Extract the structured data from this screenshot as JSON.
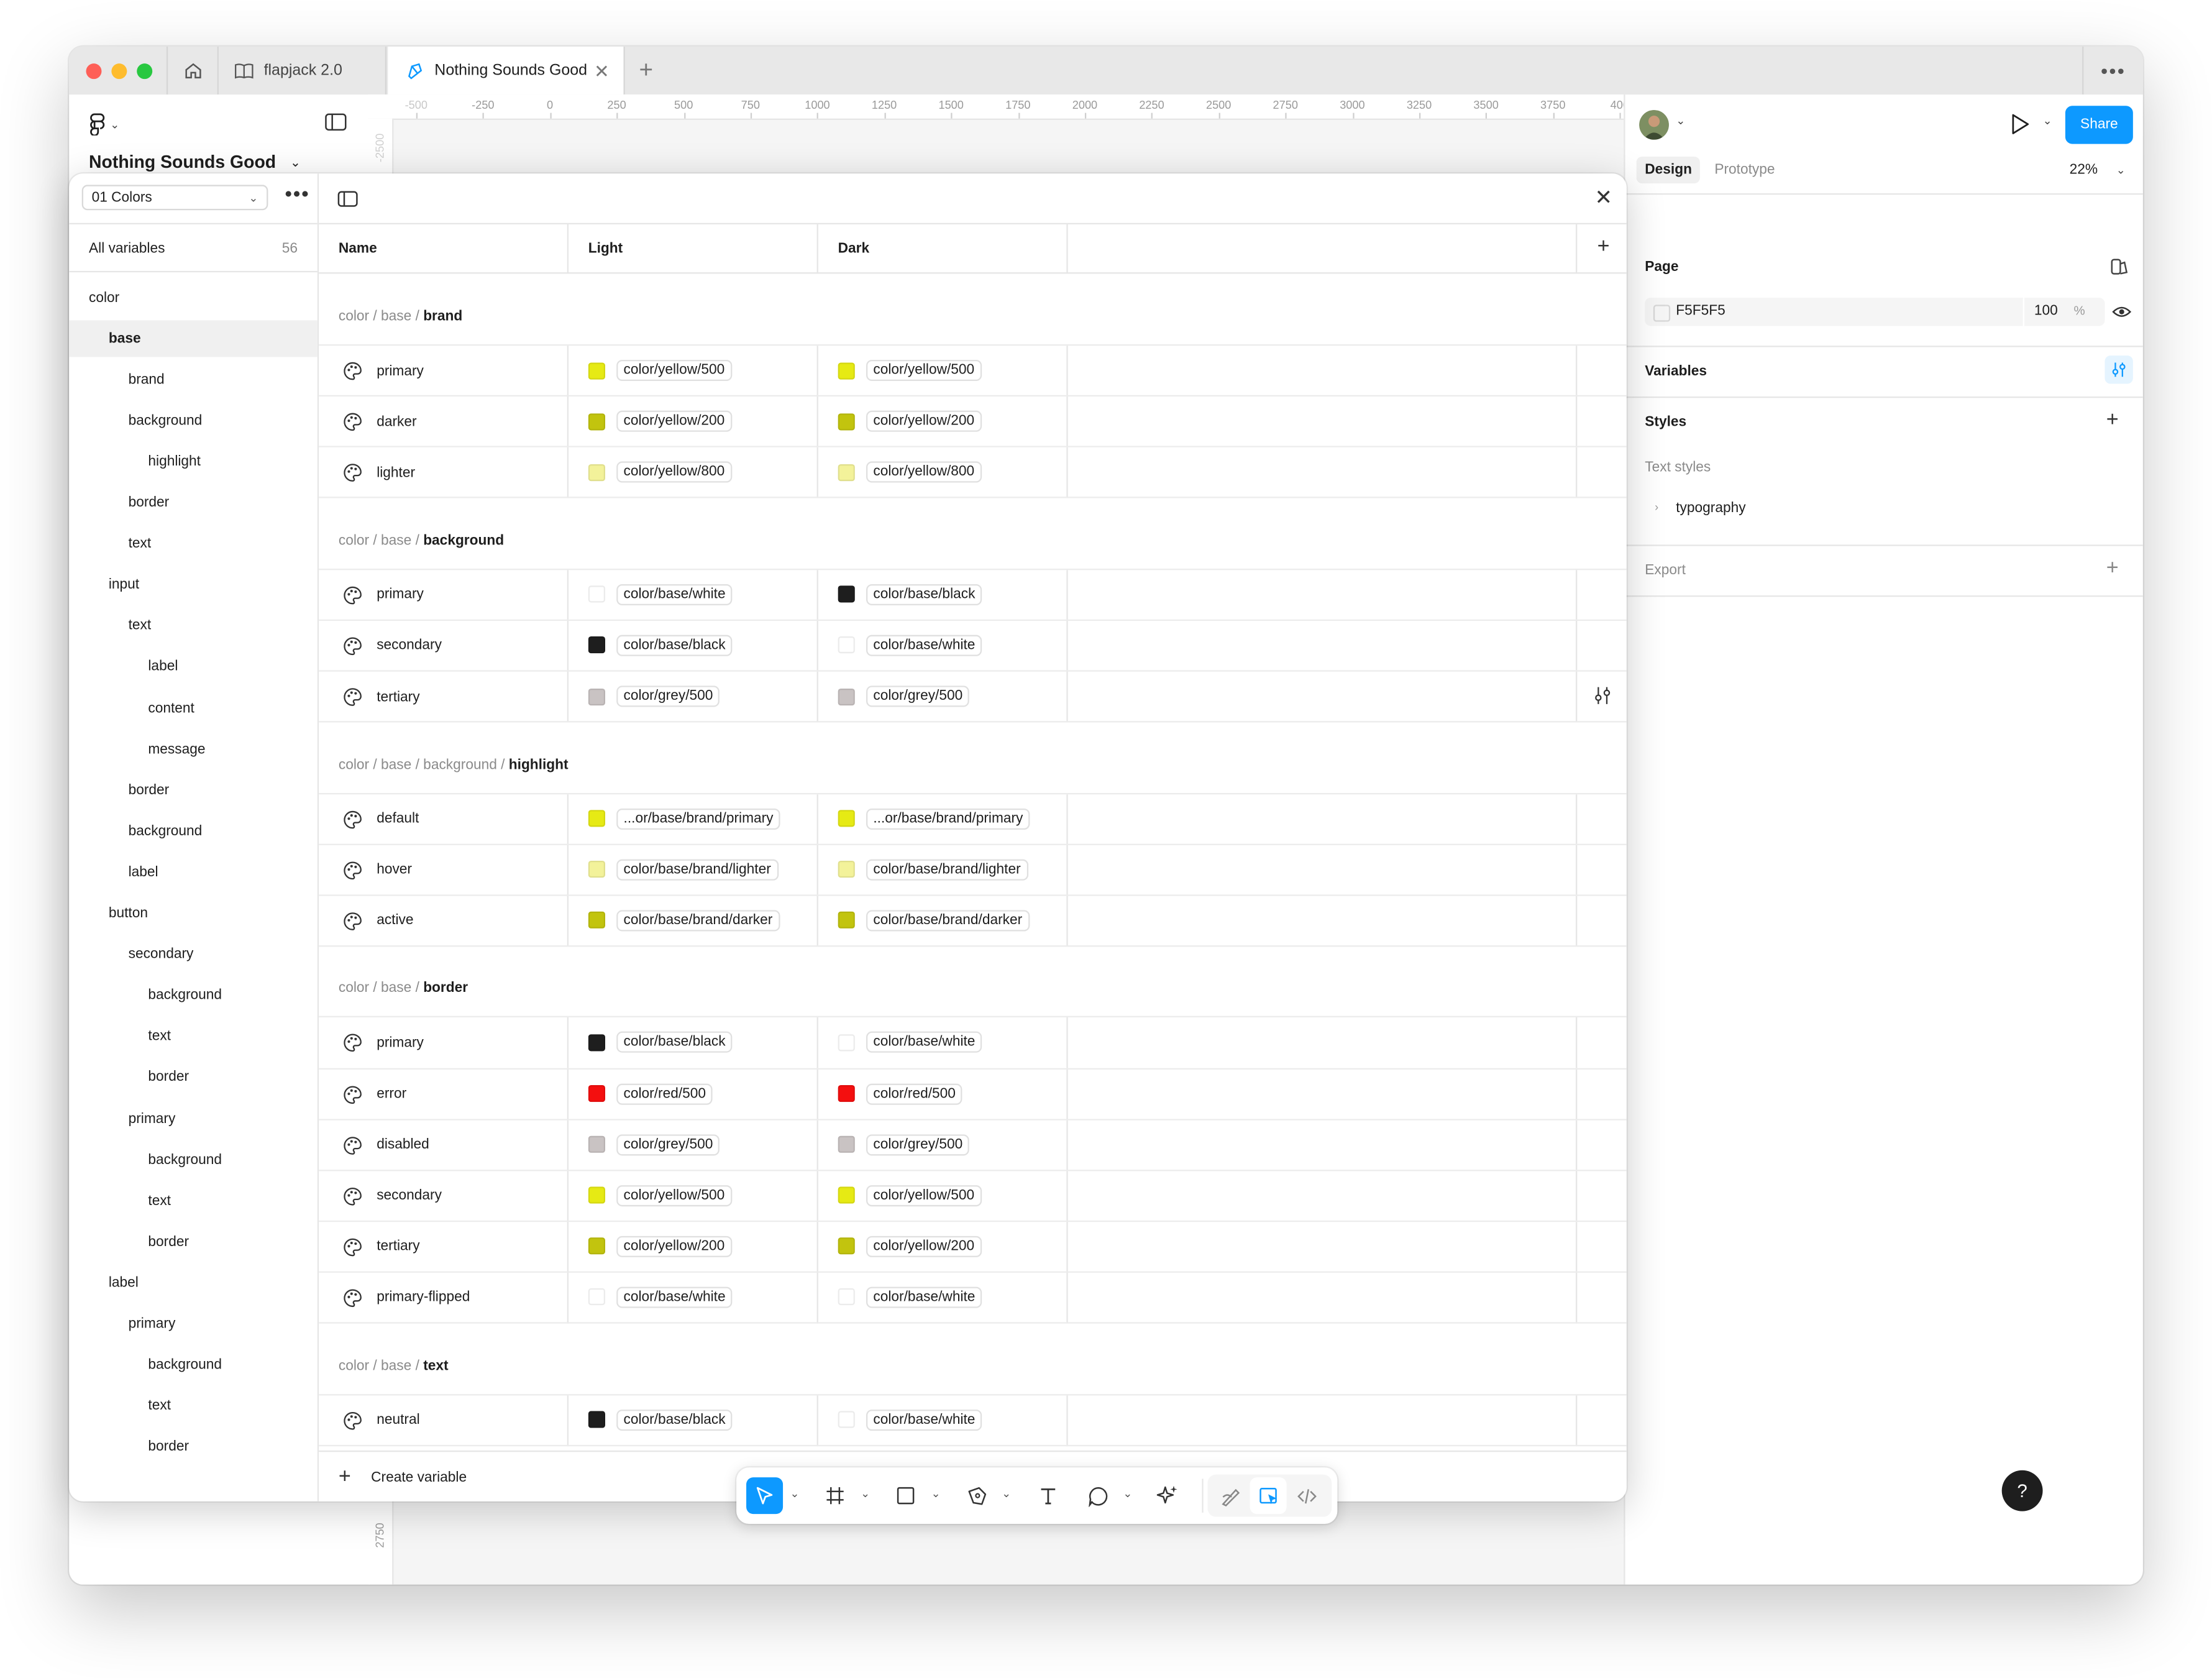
{
  "window": {
    "tabs": [
      {
        "label": "flapjack 2.0"
      },
      {
        "label": "Nothing Sounds Good"
      }
    ]
  },
  "left_panel": {
    "file_name": "Nothing Sounds Good"
  },
  "ruler": {
    "h_labels": [
      "-500",
      "-250",
      "0",
      "250",
      "500",
      "750",
      "1000",
      "1250",
      "1500",
      "1750",
      "2000",
      "2250",
      "2500",
      "2750",
      "3000",
      "3250",
      "3500",
      "3750",
      "400"
    ],
    "v_labels": [
      "-2500",
      "2750"
    ]
  },
  "variables_modal": {
    "collection": "01 Colors",
    "all_variables_label": "All variables",
    "all_variables_count": "56",
    "tree": [
      {
        "label": "color",
        "level": 0,
        "selected": false
      },
      {
        "label": "base",
        "level": 1,
        "selected": true
      },
      {
        "label": "brand",
        "level": 2,
        "selected": false
      },
      {
        "label": "background",
        "level": 2,
        "selected": false
      },
      {
        "label": "highlight",
        "level": 3,
        "selected": false
      },
      {
        "label": "border",
        "level": 2,
        "selected": false
      },
      {
        "label": "text",
        "level": 2,
        "selected": false
      },
      {
        "label": "input",
        "level": 1,
        "selected": false
      },
      {
        "label": "text",
        "level": 2,
        "selected": false
      },
      {
        "label": "label",
        "level": 3,
        "selected": false
      },
      {
        "label": "content",
        "level": 3,
        "selected": false
      },
      {
        "label": "message",
        "level": 3,
        "selected": false
      },
      {
        "label": "border",
        "level": 2,
        "selected": false
      },
      {
        "label": "background",
        "level": 2,
        "selected": false
      },
      {
        "label": "label",
        "level": 2,
        "selected": false
      },
      {
        "label": "button",
        "level": 1,
        "selected": false
      },
      {
        "label": "secondary",
        "level": 2,
        "selected": false
      },
      {
        "label": "background",
        "level": 3,
        "selected": false
      },
      {
        "label": "text",
        "level": 3,
        "selected": false
      },
      {
        "label": "border",
        "level": 3,
        "selected": false
      },
      {
        "label": "primary",
        "level": 2,
        "selected": false
      },
      {
        "label": "background",
        "level": 3,
        "selected": false
      },
      {
        "label": "text",
        "level": 3,
        "selected": false
      },
      {
        "label": "border",
        "level": 3,
        "selected": false
      },
      {
        "label": "label",
        "level": 1,
        "selected": false
      },
      {
        "label": "primary",
        "level": 2,
        "selected": false
      },
      {
        "label": "background",
        "level": 3,
        "selected": false
      },
      {
        "label": "text",
        "level": 3,
        "selected": false
      },
      {
        "label": "border",
        "level": 3,
        "selected": false
      }
    ],
    "columns": {
      "name": "Name",
      "light": "Light",
      "dark": "Dark"
    },
    "groups": [
      {
        "path": "color / base / ",
        "leaf": "brand",
        "rows": [
          {
            "name": "primary",
            "light": {
              "color": "#e6ea14",
              "ref": "color/yellow/500"
            },
            "dark": {
              "color": "#e6ea14",
              "ref": "color/yellow/500"
            }
          },
          {
            "name": "darker",
            "light": {
              "color": "#c2c40e",
              "ref": "color/yellow/200"
            },
            "dark": {
              "color": "#c2c40e",
              "ref": "color/yellow/200"
            }
          },
          {
            "name": "lighter",
            "light": {
              "color": "#f3f29a",
              "ref": "color/yellow/800"
            },
            "dark": {
              "color": "#f3f29a",
              "ref": "color/yellow/800"
            }
          }
        ]
      },
      {
        "path": "color / base / ",
        "leaf": "background",
        "rows": [
          {
            "name": "primary",
            "light": {
              "color": "#ffffff",
              "ref": "color/base/white"
            },
            "dark": {
              "color": "#1e1e1e",
              "ref": "color/base/black"
            }
          },
          {
            "name": "secondary",
            "light": {
              "color": "#1e1e1e",
              "ref": "color/base/black"
            },
            "dark": {
              "color": "#ffffff",
              "ref": "color/base/white"
            }
          },
          {
            "name": "tertiary",
            "light": {
              "color": "#c9c3c3",
              "ref": "color/grey/500"
            },
            "dark": {
              "color": "#c9c3c3",
              "ref": "color/grey/500"
            }
          }
        ]
      },
      {
        "path": "color / base / background / ",
        "leaf": "highlight",
        "rows": [
          {
            "name": "default",
            "light": {
              "color": "#e6ea14",
              "ref": "...or/base/brand/primary"
            },
            "dark": {
              "color": "#e6ea14",
              "ref": "...or/base/brand/primary"
            }
          },
          {
            "name": "hover",
            "light": {
              "color": "#f3f29a",
              "ref": "color/base/brand/lighter"
            },
            "dark": {
              "color": "#f3f29a",
              "ref": "color/base/brand/lighter"
            }
          },
          {
            "name": "active",
            "light": {
              "color": "#c2c40e",
              "ref": "color/base/brand/darker"
            },
            "dark": {
              "color": "#c2c40e",
              "ref": "color/base/brand/darker"
            }
          }
        ]
      },
      {
        "path": "color / base / ",
        "leaf": "border",
        "rows": [
          {
            "name": "primary",
            "light": {
              "color": "#1e1e1e",
              "ref": "color/base/black"
            },
            "dark": {
              "color": "#ffffff",
              "ref": "color/base/white"
            }
          },
          {
            "name": "error",
            "light": {
              "color": "#f40f0f",
              "ref": "color/red/500"
            },
            "dark": {
              "color": "#f40f0f",
              "ref": "color/red/500"
            }
          },
          {
            "name": "disabled",
            "light": {
              "color": "#c9c3c3",
              "ref": "color/grey/500"
            },
            "dark": {
              "color": "#c9c3c3",
              "ref": "color/grey/500"
            }
          },
          {
            "name": "secondary",
            "light": {
              "color": "#e6ea14",
              "ref": "color/yellow/500"
            },
            "dark": {
              "color": "#e6ea14",
              "ref": "color/yellow/500"
            }
          },
          {
            "name": "tertiary",
            "light": {
              "color": "#c2c40e",
              "ref": "color/yellow/200"
            },
            "dark": {
              "color": "#c2c40e",
              "ref": "color/yellow/200"
            }
          },
          {
            "name": "primary-flipped",
            "light": {
              "color": "#ffffff",
              "ref": "color/base/white"
            },
            "dark": {
              "color": "#ffffff",
              "ref": "color/base/white"
            }
          }
        ]
      },
      {
        "path": "color / base / ",
        "leaf": "text",
        "rows": [
          {
            "name": "neutral",
            "light": {
              "color": "#1e1e1e",
              "ref": "color/base/black"
            },
            "dark": {
              "color": "#ffffff",
              "ref": "color/base/white"
            }
          }
        ]
      }
    ],
    "create_label": "Create variable"
  },
  "right_panel": {
    "share_label": "Share",
    "tabs": [
      "Design",
      "Prototype"
    ],
    "zoom": "22%",
    "page_heading": "Page",
    "page_color": "F5F5F5",
    "page_opacity": "100",
    "page_opacity_unit": "%",
    "variables_heading": "Variables",
    "styles_heading": "Styles",
    "text_styles_label": "Text styles",
    "typography_label": "typography",
    "export_heading": "Export"
  },
  "help_label": "?",
  "colors": {
    "accent": "#0d99ff",
    "canvas": "#f5f5f5"
  }
}
